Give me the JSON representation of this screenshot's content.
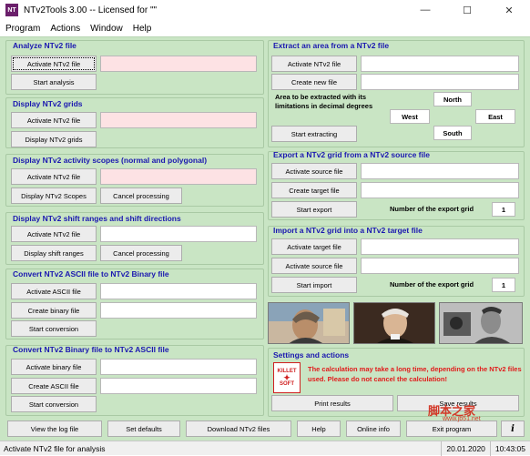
{
  "window": {
    "title": "NTv2Tools 3.00 -- Licensed for \"\"",
    "app_icon": "NT",
    "minimize": "—",
    "maximize": "☐",
    "close": "✕"
  },
  "menu": [
    "Program",
    "Actions",
    "Window",
    "Help"
  ],
  "analyze": {
    "title": "Analyze NTv2 file",
    "activate": "Activate NTv2 file",
    "start": "Start analysis"
  },
  "display_grids": {
    "title": "Display NTv2 grids",
    "activate": "Activate NTv2 file",
    "display": "Display NTv2 grids"
  },
  "display_scopes": {
    "title": "Display NTv2 activity scopes (normal and polygonal)",
    "activate": "Activate NTv2 file",
    "display": "Display NTv2 Scopes",
    "cancel": "Cancel processing"
  },
  "display_shifts": {
    "title": "Display NTv2 shift ranges and shift directions",
    "activate": "Activate NTv2 file",
    "display": "Display shift ranges",
    "cancel": "Cancel processing"
  },
  "ascii_to_binary": {
    "title": "Convert NTv2 ASCII file to NTv2 Binary file",
    "activate": "Activate ASCII file",
    "create": "Create binary file",
    "start": "Start conversion"
  },
  "binary_to_ascii": {
    "title": "Convert NTv2 Binary file to NTv2 ASCII file",
    "activate": "Activate binary file",
    "create": "Create ASCII file",
    "start": "Start conversion"
  },
  "extract_area": {
    "title": "Extract an area from a NTv2 file",
    "activate": "Activate NTv2 file",
    "create": "Create new file",
    "area_label": "Area to be extracted with its limitations in decimal degrees",
    "north": "North",
    "west": "West",
    "east": "East",
    "south": "South",
    "start": "Start extracting"
  },
  "extract_grid": {
    "title": "Export a NTv2 grid from a NTv2 source file",
    "activate": "Activate source file",
    "create": "Create target file",
    "start": "Start export",
    "number_label": "Number of the export grid",
    "number": "1"
  },
  "import_grid": {
    "title": "Import a NTv2 grid into a NTv2 target file",
    "activate": "Activate target file",
    "source": "Activate source file",
    "start": "Start import",
    "number_label": "Number of the export grid",
    "number": "1"
  },
  "settings": {
    "title": "Settings and actions",
    "logo_top": "KILLET",
    "logo_bottom": "SOFT",
    "warning": "The calculation may take a long time, depending on the NTv2 files used. Please do not cancel the calculation!",
    "print": "Print results",
    "save": "Save results"
  },
  "bottom_buttons": {
    "log": "View the log file",
    "defaults": "Set defaults",
    "download": "Download NTv2 files",
    "help": "Help",
    "online": "Online info",
    "exit": "Exit program",
    "info_icon": "i"
  },
  "status": {
    "text": "Activate NTv2 file for analysis",
    "date": "20.01.2020",
    "time": "10:43:05"
  },
  "watermark": {
    "text": "脚本之家",
    "url": "www.jb51.net"
  }
}
